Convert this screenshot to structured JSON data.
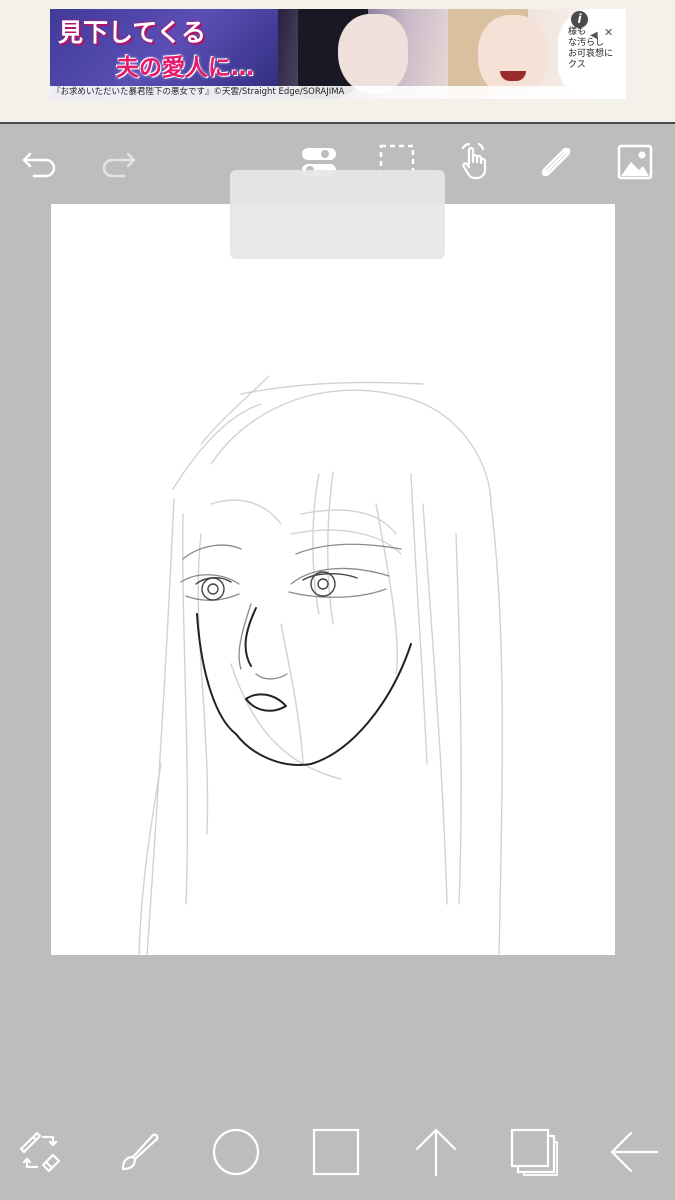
{
  "ad": {
    "title_line1": "見下してくる",
    "title_line2": "夫の愛人に…",
    "bubble_text": "様も\nな汚らし\nお可哀想に\nクス",
    "caption": "『お求めいただいた暴君陛下の悪女です』©天雲/Straight Edge/SORAJIMA",
    "info_label": "i",
    "close_label": "✕",
    "mute_label": "◀"
  },
  "top_toolbar": {
    "items": [
      {
        "name": "undo",
        "icon": "undo-icon"
      },
      {
        "name": "redo",
        "icon": "redo-icon"
      },
      {
        "name": "toggle-panel",
        "icon": "toggle-icon"
      },
      {
        "name": "selection",
        "icon": "selection-icon"
      },
      {
        "name": "hand",
        "icon": "hand-icon"
      },
      {
        "name": "ruler",
        "icon": "ruler-icon"
      },
      {
        "name": "layers-image",
        "icon": "image-icon"
      }
    ]
  },
  "popup": {
    "label": ""
  },
  "bottom_toolbar": {
    "items": [
      {
        "name": "brush-eraser-switch",
        "icon": "brush-eraser-swap-icon"
      },
      {
        "name": "brush",
        "icon": "brush-icon"
      },
      {
        "name": "color",
        "icon": "color-circle-icon"
      },
      {
        "name": "material",
        "icon": "square-icon"
      },
      {
        "name": "share",
        "icon": "arrow-up-icon"
      },
      {
        "name": "layers",
        "icon": "layers-icon"
      },
      {
        "name": "back",
        "icon": "arrow-left-icon"
      }
    ]
  },
  "colors": {
    "workspace_bg": "#bdbdbd",
    "canvas_bg": "#ffffff",
    "icon_color": "#ffffff"
  }
}
